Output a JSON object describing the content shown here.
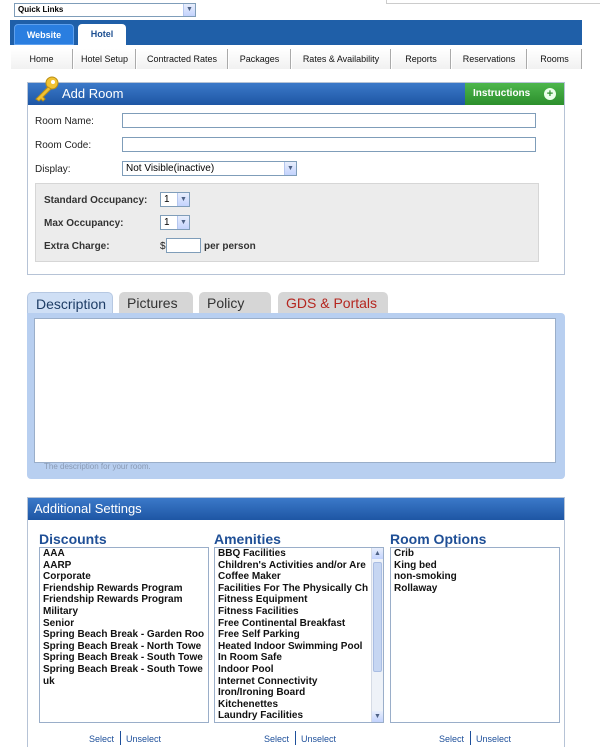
{
  "topbar": {
    "quick_links": "Quick Links"
  },
  "main_tabs": {
    "website": "Website",
    "hotel": "Hotel"
  },
  "nav": [
    "Home",
    "Hotel Setup",
    "Contracted Rates",
    "Packages",
    "Rates & Availability",
    "Reports",
    "Reservations",
    "Rooms"
  ],
  "add_room": {
    "title": "Add Room",
    "instructions": "Instructions",
    "room_name_label": "Room Name:",
    "room_code_label": "Room Code:",
    "display_label": "Display:",
    "display_value": "Not Visible(inactive)",
    "standard_occupancy_label": "Standard Occupancy:",
    "standard_occupancy_value": "1",
    "max_occupancy_label": "Max Occupancy:",
    "max_occupancy_value": "1",
    "extra_charge_label": "Extra Charge:",
    "currency": "$",
    "per_person": "per person"
  },
  "desc_tabs": {
    "description": "Description",
    "pictures": "Pictures",
    "policy": "Policy",
    "gds": "GDS & Portals"
  },
  "description_hint": "The description for your room.",
  "settings": {
    "title": "Additional Settings",
    "discounts_title": "Discounts",
    "amenities_title": "Amenities",
    "room_options_title": "Room Options",
    "select": "Select",
    "unselect": "Unselect",
    "discounts": [
      "AAA",
      "AARP",
      "Corporate",
      "Friendship Rewards Program",
      "Friendship Rewards Program",
      "Military",
      "Senior",
      "Spring Beach Break - Garden Roo",
      "Spring Beach Break - North Towe",
      "Spring Beach Break - South Towe",
      "Spring Beach Break - South Towe",
      "uk"
    ],
    "amenities": [
      "BBQ Facilities",
      "Children's Activities and/or Are",
      "Coffee Maker",
      "Facilities For The Physically Ch",
      "Fitness Equipment",
      "Fitness Facilities",
      "Free Continental Breakfast",
      "Free Self Parking",
      "Heated Indoor Swimming Pool",
      "In Room Safe",
      "Indoor Pool",
      "Internet Connectivity",
      "Iron/Ironing Board",
      "Kitchenettes",
      "Laundry Facilities"
    ],
    "room_options": [
      "Crib",
      "King bed",
      "non-smoking",
      "Rollaway"
    ]
  }
}
